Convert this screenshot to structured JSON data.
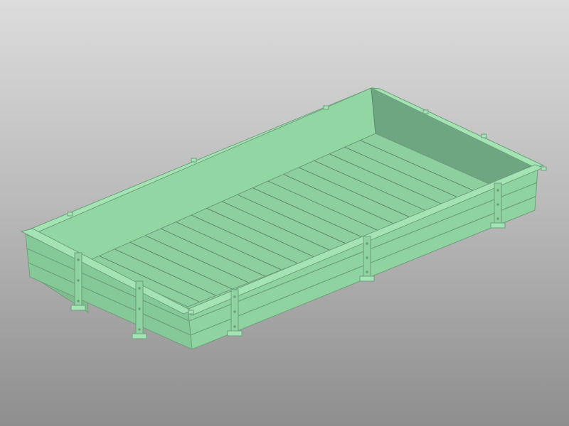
{
  "viewer": {
    "background": {
      "top": "#dcdcdc",
      "middle": "#bcbcbc",
      "bottom": "#8e8e8e"
    }
  },
  "model": {
    "name": "",
    "colors": {
      "base": "#8fd3a0",
      "top_light": "#a4e3b3",
      "shadow": "#6e9f7c",
      "line": "#5f8a6b",
      "end_wall_face": "#6fa682",
      "floor": "#8dcf9e"
    },
    "floor_plank_count": 19,
    "front_side_plank_count": 3,
    "stake_count_front": 4,
    "stake_count_left_end": 2
  }
}
